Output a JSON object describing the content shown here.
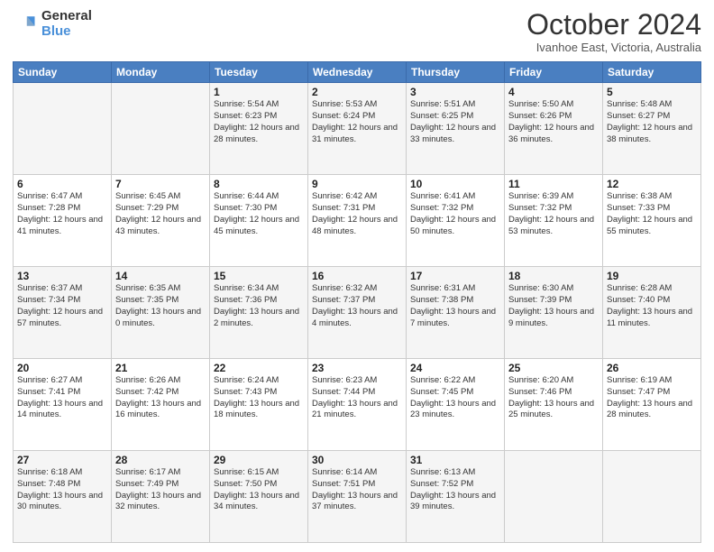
{
  "logo": {
    "general": "General",
    "blue": "Blue"
  },
  "title": "October 2024",
  "subtitle": "Ivanhoe East, Victoria, Australia",
  "days_of_week": [
    "Sunday",
    "Monday",
    "Tuesday",
    "Wednesday",
    "Thursday",
    "Friday",
    "Saturday"
  ],
  "weeks": [
    [
      {
        "day": "",
        "info": ""
      },
      {
        "day": "",
        "info": ""
      },
      {
        "day": "1",
        "info": "Sunrise: 5:54 AM\nSunset: 6:23 PM\nDaylight: 12 hours and 28 minutes."
      },
      {
        "day": "2",
        "info": "Sunrise: 5:53 AM\nSunset: 6:24 PM\nDaylight: 12 hours and 31 minutes."
      },
      {
        "day": "3",
        "info": "Sunrise: 5:51 AM\nSunset: 6:25 PM\nDaylight: 12 hours and 33 minutes."
      },
      {
        "day": "4",
        "info": "Sunrise: 5:50 AM\nSunset: 6:26 PM\nDaylight: 12 hours and 36 minutes."
      },
      {
        "day": "5",
        "info": "Sunrise: 5:48 AM\nSunset: 6:27 PM\nDaylight: 12 hours and 38 minutes."
      }
    ],
    [
      {
        "day": "6",
        "info": "Sunrise: 6:47 AM\nSunset: 7:28 PM\nDaylight: 12 hours and 41 minutes."
      },
      {
        "day": "7",
        "info": "Sunrise: 6:45 AM\nSunset: 7:29 PM\nDaylight: 12 hours and 43 minutes."
      },
      {
        "day": "8",
        "info": "Sunrise: 6:44 AM\nSunset: 7:30 PM\nDaylight: 12 hours and 45 minutes."
      },
      {
        "day": "9",
        "info": "Sunrise: 6:42 AM\nSunset: 7:31 PM\nDaylight: 12 hours and 48 minutes."
      },
      {
        "day": "10",
        "info": "Sunrise: 6:41 AM\nSunset: 7:32 PM\nDaylight: 12 hours and 50 minutes."
      },
      {
        "day": "11",
        "info": "Sunrise: 6:39 AM\nSunset: 7:32 PM\nDaylight: 12 hours and 53 minutes."
      },
      {
        "day": "12",
        "info": "Sunrise: 6:38 AM\nSunset: 7:33 PM\nDaylight: 12 hours and 55 minutes."
      }
    ],
    [
      {
        "day": "13",
        "info": "Sunrise: 6:37 AM\nSunset: 7:34 PM\nDaylight: 12 hours and 57 minutes."
      },
      {
        "day": "14",
        "info": "Sunrise: 6:35 AM\nSunset: 7:35 PM\nDaylight: 13 hours and 0 minutes."
      },
      {
        "day": "15",
        "info": "Sunrise: 6:34 AM\nSunset: 7:36 PM\nDaylight: 13 hours and 2 minutes."
      },
      {
        "day": "16",
        "info": "Sunrise: 6:32 AM\nSunset: 7:37 PM\nDaylight: 13 hours and 4 minutes."
      },
      {
        "day": "17",
        "info": "Sunrise: 6:31 AM\nSunset: 7:38 PM\nDaylight: 13 hours and 7 minutes."
      },
      {
        "day": "18",
        "info": "Sunrise: 6:30 AM\nSunset: 7:39 PM\nDaylight: 13 hours and 9 minutes."
      },
      {
        "day": "19",
        "info": "Sunrise: 6:28 AM\nSunset: 7:40 PM\nDaylight: 13 hours and 11 minutes."
      }
    ],
    [
      {
        "day": "20",
        "info": "Sunrise: 6:27 AM\nSunset: 7:41 PM\nDaylight: 13 hours and 14 minutes."
      },
      {
        "day": "21",
        "info": "Sunrise: 6:26 AM\nSunset: 7:42 PM\nDaylight: 13 hours and 16 minutes."
      },
      {
        "day": "22",
        "info": "Sunrise: 6:24 AM\nSunset: 7:43 PM\nDaylight: 13 hours and 18 minutes."
      },
      {
        "day": "23",
        "info": "Sunrise: 6:23 AM\nSunset: 7:44 PM\nDaylight: 13 hours and 21 minutes."
      },
      {
        "day": "24",
        "info": "Sunrise: 6:22 AM\nSunset: 7:45 PM\nDaylight: 13 hours and 23 minutes."
      },
      {
        "day": "25",
        "info": "Sunrise: 6:20 AM\nSunset: 7:46 PM\nDaylight: 13 hours and 25 minutes."
      },
      {
        "day": "26",
        "info": "Sunrise: 6:19 AM\nSunset: 7:47 PM\nDaylight: 13 hours and 28 minutes."
      }
    ],
    [
      {
        "day": "27",
        "info": "Sunrise: 6:18 AM\nSunset: 7:48 PM\nDaylight: 13 hours and 30 minutes."
      },
      {
        "day": "28",
        "info": "Sunrise: 6:17 AM\nSunset: 7:49 PM\nDaylight: 13 hours and 32 minutes."
      },
      {
        "day": "29",
        "info": "Sunrise: 6:15 AM\nSunset: 7:50 PM\nDaylight: 13 hours and 34 minutes."
      },
      {
        "day": "30",
        "info": "Sunrise: 6:14 AM\nSunset: 7:51 PM\nDaylight: 13 hours and 37 minutes."
      },
      {
        "day": "31",
        "info": "Sunrise: 6:13 AM\nSunset: 7:52 PM\nDaylight: 13 hours and 39 minutes."
      },
      {
        "day": "",
        "info": ""
      },
      {
        "day": "",
        "info": ""
      }
    ]
  ]
}
